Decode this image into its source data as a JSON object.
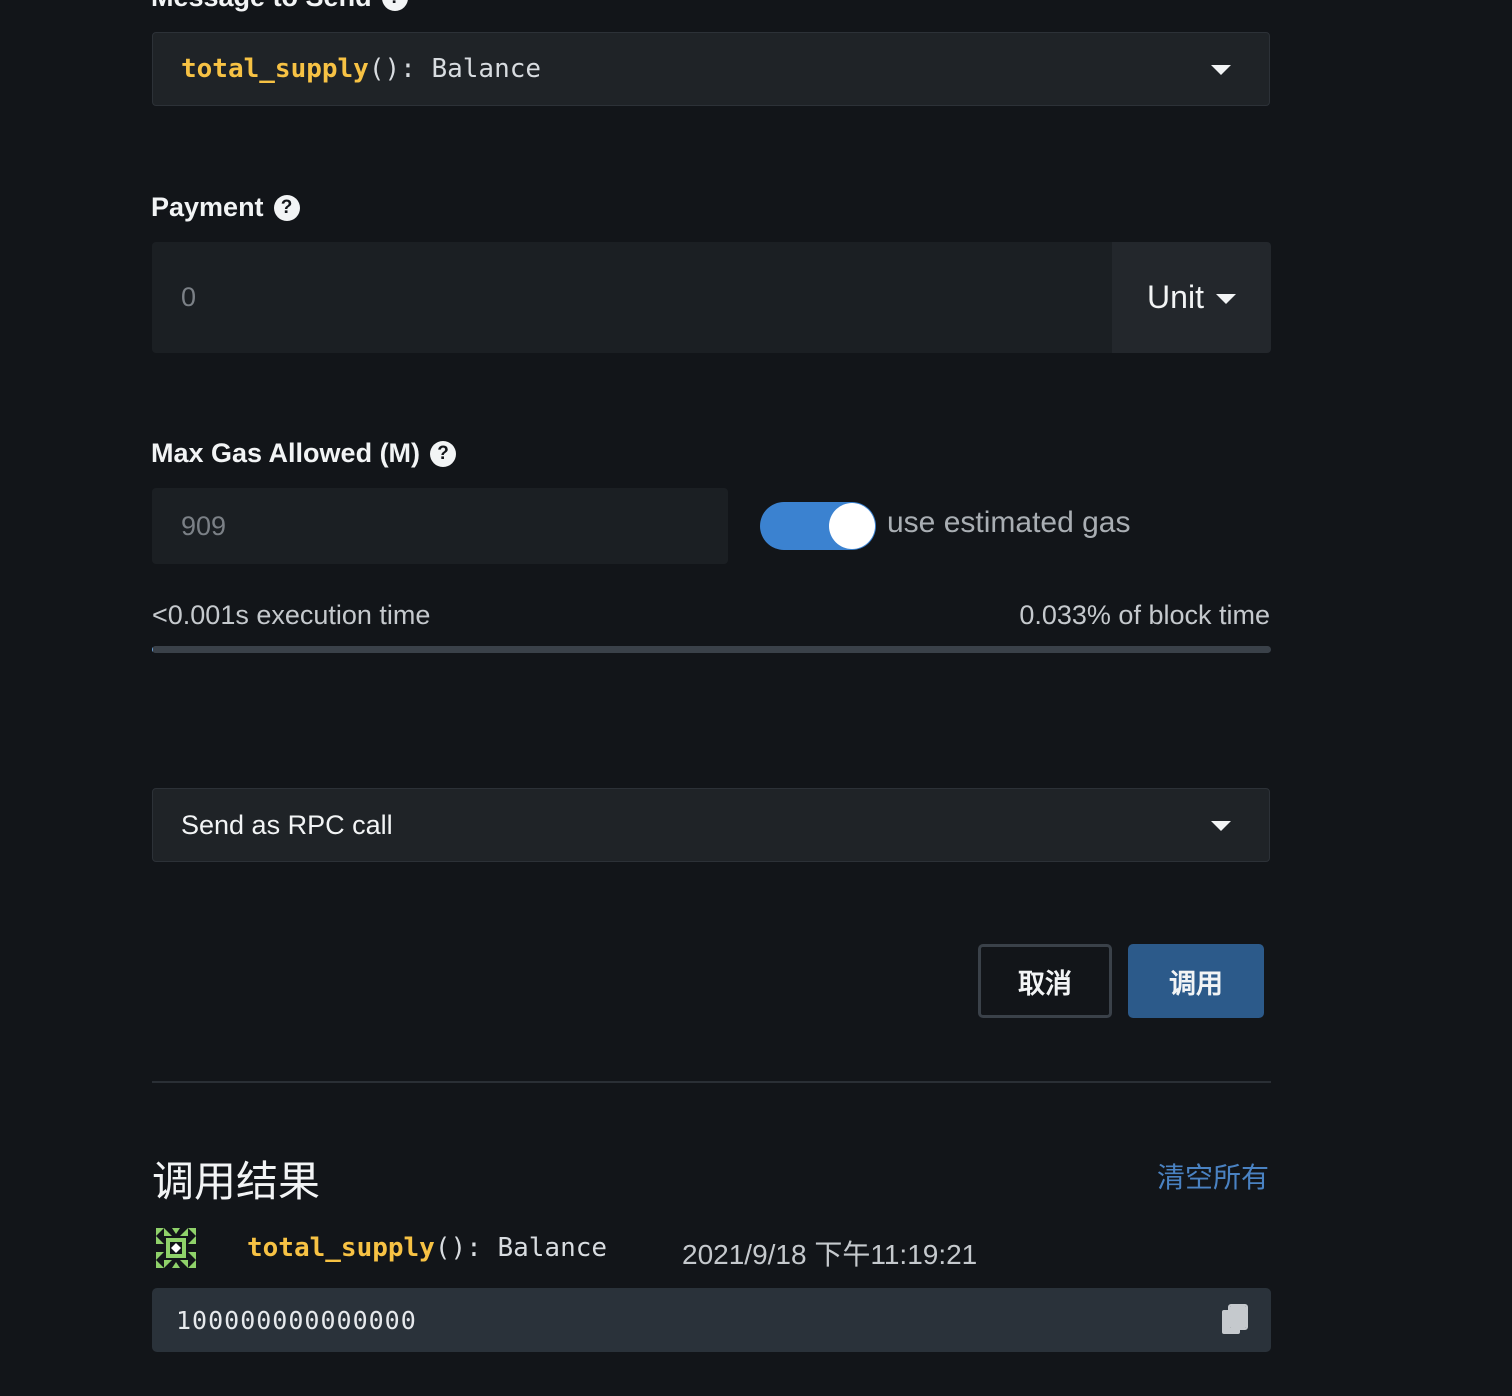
{
  "message": {
    "label": "Message to Send",
    "fn_name": "total_supply",
    "fn_parens": "()",
    "fn_colon": ":",
    "fn_return": "Balance"
  },
  "payment": {
    "label": "Payment",
    "placeholder": "0",
    "unit_label": "Unit"
  },
  "gas": {
    "label": "Max Gas Allowed (M)",
    "placeholder": "909",
    "toggle_label": "use estimated gas",
    "toggle_on": true,
    "execution_time": "<0.001s execution time",
    "block_time": "0.033% of block time",
    "block_fraction": 0.00033
  },
  "send_mode": {
    "value": "Send as RPC call"
  },
  "actions": {
    "cancel_label": "取消",
    "call_label": "调用"
  },
  "results": {
    "title": "调用结果",
    "clear_label": "清空所有",
    "items": [
      {
        "fn_name": "total_supply",
        "fn_parens": "()",
        "fn_colon": ":",
        "fn_return": "Balance",
        "timestamp": "2021/9/18 下午11:19:21",
        "value": "100000000000000"
      }
    ]
  },
  "colors": {
    "accent": "#3b82d0",
    "primary_button": "#2c5a8a",
    "function_name": "#f7c244",
    "link": "#4a82c2",
    "background": "#121519"
  },
  "icons": {
    "help": "question-circle-icon",
    "caret": "caret-down-icon",
    "copy": "copy-icon",
    "avatar": "identicon-avatar"
  }
}
